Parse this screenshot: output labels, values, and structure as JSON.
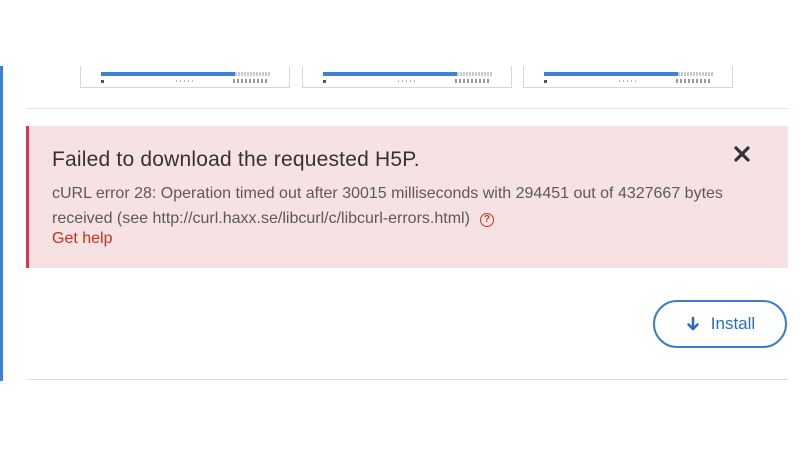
{
  "alert": {
    "title": "Failed to download the requested H5P.",
    "message": "cURL error 28: Operation timed out after 30015 milliseconds with 294451 out of 4327667 bytes received (see http://curl.haxx.se/libcurl/c/libcurl-errors.html)",
    "help_glyph": "?",
    "help_link": "Get help",
    "close_icon": "close-icon",
    "background_color": "#f6e1e4",
    "border_color": "#d9374d",
    "link_color": "#c0341d"
  },
  "install": {
    "label": "Install",
    "icon": "arrow-down-icon",
    "color": "#2a6ebb"
  },
  "accent_color": "#3b82d6"
}
